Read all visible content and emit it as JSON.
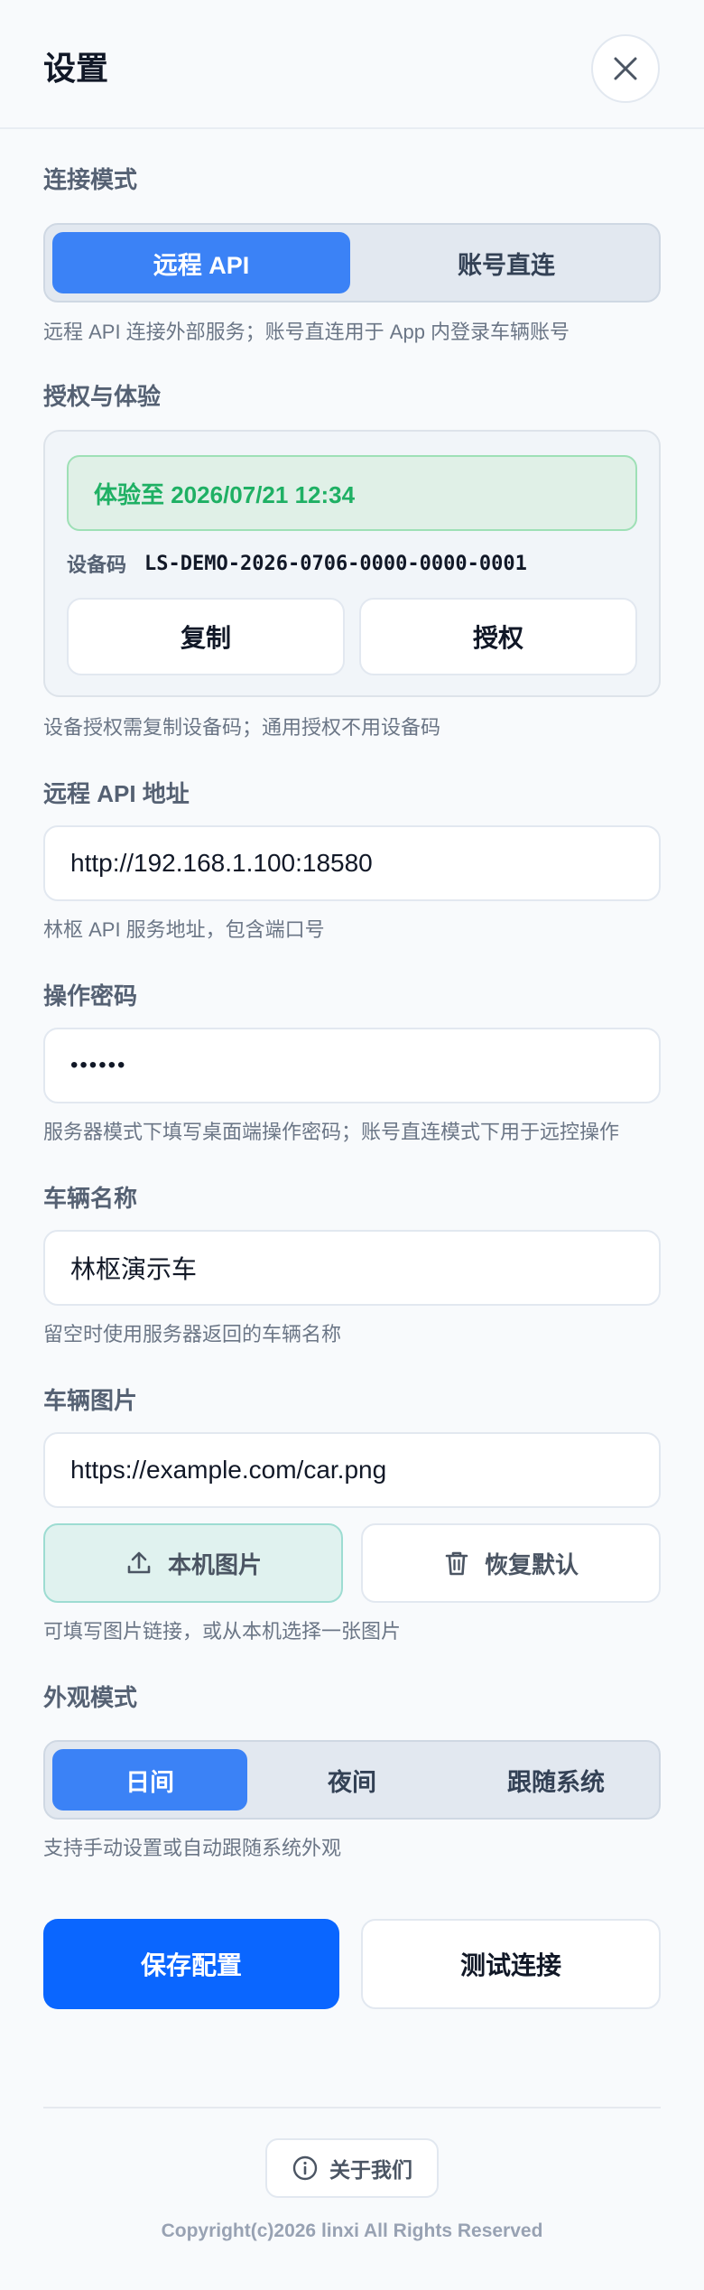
{
  "header": {
    "title": "设置",
    "close_icon": "close-icon"
  },
  "connection": {
    "label": "连接模式",
    "options": [
      "远程 API",
      "账号直连"
    ],
    "selected": "远程 API",
    "hint": "远程 API 连接外部服务；账号直连用于 App 内登录车辆账号"
  },
  "auth": {
    "label": "授权与体验",
    "trial_text": "体验至 2026/07/21 12:34",
    "device_label": "设备码",
    "device_code": "LS-DEMO-2026-0706-0000-0000-0001",
    "copy_label": "复制",
    "authorize_label": "授权",
    "hint": "设备授权需复制设备码；通用授权不用设备码"
  },
  "api": {
    "label": "远程 API 地址",
    "value": "http://192.168.1.100:18580",
    "hint": "林枢 API 服务地址，包含端口号"
  },
  "password": {
    "label": "操作密码",
    "value": "••••••",
    "hint": "服务器模式下填写桌面端操作密码；账号直连模式下用于远控操作"
  },
  "vehicle_name": {
    "label": "车辆名称",
    "value": "林枢演示车",
    "hint": "留空时使用服务器返回的车辆名称"
  },
  "vehicle_image": {
    "label": "车辆图片",
    "value": "https://example.com/car.png",
    "local_label": "本机图片",
    "restore_label": "恢复默认",
    "hint": "可填写图片链接，或从本机选择一张图片"
  },
  "appearance": {
    "label": "外观模式",
    "options": [
      "日间",
      "夜间",
      "跟随系统"
    ],
    "selected": "日间",
    "hint": "支持手动设置或自动跟随系统外观"
  },
  "actions": {
    "save_label": "保存配置",
    "test_label": "测试连接"
  },
  "footer": {
    "about_label": "关于我们",
    "copyright": "Copyright(c)2026 linxi All Rights Reserved"
  },
  "colors": {
    "accent": "#3b82f6",
    "primary": "#0a66ff",
    "success": "#1fb064"
  }
}
